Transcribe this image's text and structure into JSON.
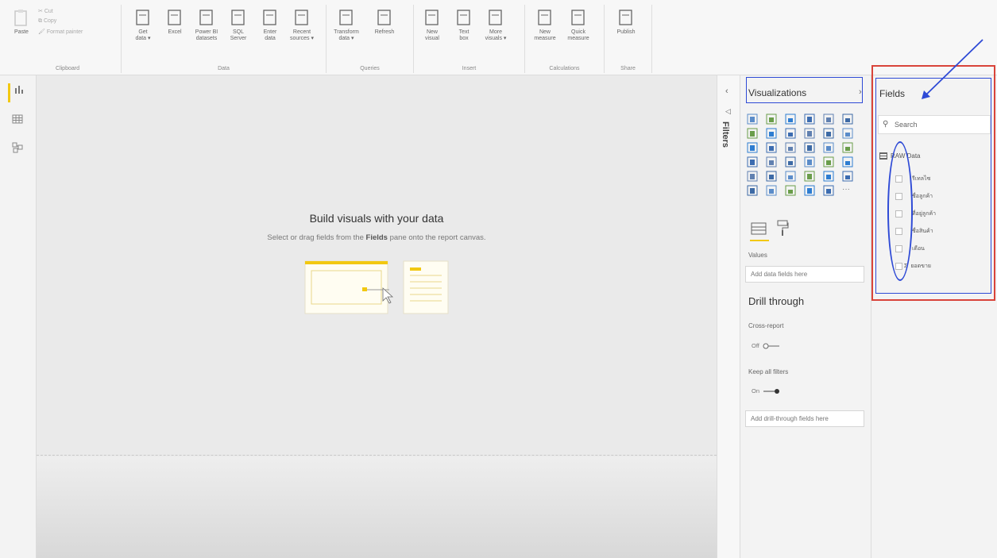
{
  "ribbon": {
    "clipboard": {
      "paste": "Paste",
      "cut": "Cut",
      "copy": "Copy",
      "format_painter": "Format painter",
      "label": "Clipboard"
    },
    "data": {
      "label": "Data",
      "buttons": [
        {
          "line1": "Get",
          "line2": "data ▾"
        },
        {
          "line1": "Excel",
          "line2": ""
        },
        {
          "line1": "Power BI",
          "line2": "datasets"
        },
        {
          "line1": "SQL",
          "line2": "Server"
        },
        {
          "line1": "Enter",
          "line2": "data"
        },
        {
          "line1": "Recent",
          "line2": "sources ▾"
        }
      ]
    },
    "queries": {
      "label": "Queries",
      "buttons": [
        {
          "line1": "Transform",
          "line2": "data ▾"
        },
        {
          "line1": "Refresh",
          "line2": ""
        }
      ]
    },
    "insert": {
      "label": "Insert",
      "buttons": [
        {
          "line1": "New",
          "line2": "visual"
        },
        {
          "line1": "Text",
          "line2": "box"
        },
        {
          "line1": "More",
          "line2": "visuals ▾"
        }
      ]
    },
    "calculations": {
      "label": "Calculations",
      "buttons": [
        {
          "line1": "New",
          "line2": "measure"
        },
        {
          "line1": "Quick",
          "line2": "measure"
        }
      ]
    },
    "share": {
      "label": "Share",
      "buttons": [
        {
          "line1": "Publish",
          "line2": ""
        }
      ]
    }
  },
  "canvas": {
    "title": "Build visuals with your data",
    "subtitle_before": "Select or drag fields from the ",
    "subtitle_bold": "Fields",
    "subtitle_after": " pane onto the report canvas."
  },
  "filters": {
    "label": "Filters",
    "collapse_icon": "‹"
  },
  "visualizations": {
    "title": "Visualizations",
    "expand_icon": "›",
    "more_icon": "···",
    "values_label": "Values",
    "values_drop": "Add data fields here",
    "drill_title": "Drill through",
    "cross_report_label": "Cross-report",
    "cross_report_state": "Off",
    "keep_filters_label": "Keep all filters",
    "keep_filters_state": "On",
    "drill_drop": "Add drill-through fields here"
  },
  "fields": {
    "title": "Fields",
    "search_placeholder": "Search",
    "table_name": "RAW Data",
    "items": [
      "รีเทลไซ",
      "ชื่อลูกค้า",
      "ที่อยู่ลูกค้า",
      "ชื่อสินค้า",
      "เดือน",
      "ยอดขาย"
    ],
    "last_item_sigma": "Σ"
  },
  "colors": {
    "accent": "#f2c811",
    "annotation_red": "#d9443a",
    "annotation_blue": "#2e4ad6"
  }
}
